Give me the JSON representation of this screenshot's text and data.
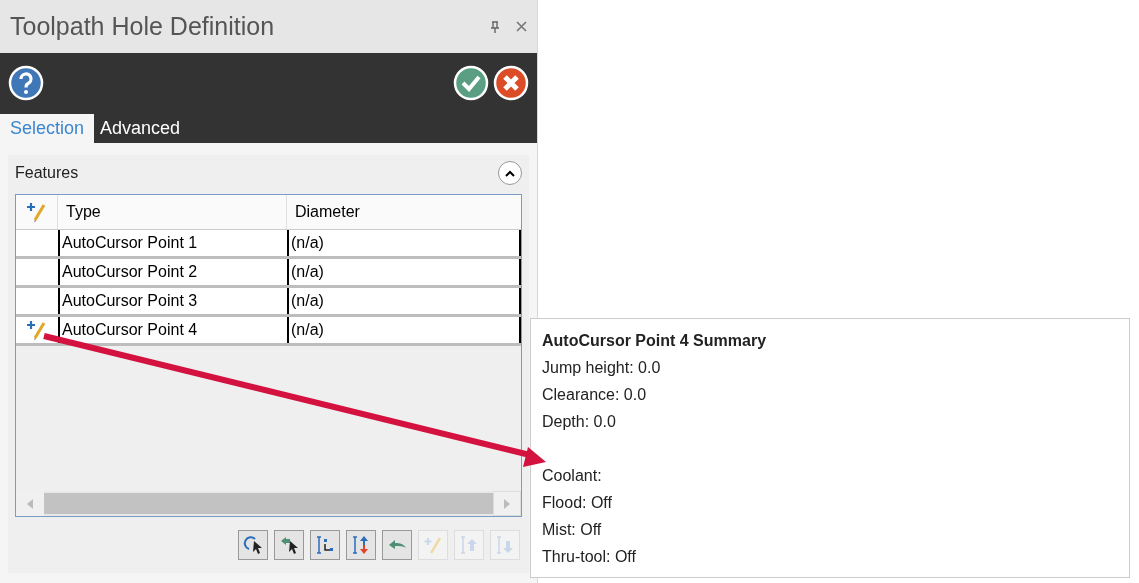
{
  "panel": {
    "title": "Toolpath Hole Definition"
  },
  "tabs": [
    {
      "label": "Selection",
      "selected": true
    },
    {
      "label": "Advanced",
      "selected": false
    }
  ],
  "group": {
    "title": "Features",
    "expanded": true
  },
  "table": {
    "columns": [
      "Type",
      "Diameter"
    ],
    "rows": [
      {
        "type": "AutoCursor Point 1",
        "diameter": "(n/a)",
        "editing": false
      },
      {
        "type": "AutoCursor Point 2",
        "diameter": "(n/a)",
        "editing": false
      },
      {
        "type": "AutoCursor Point 3",
        "diameter": "(n/a)",
        "editing": false
      },
      {
        "type": "AutoCursor Point 4",
        "diameter": "(n/a)",
        "editing": true
      }
    ]
  },
  "toolbar": [
    {
      "kind": "select",
      "disabled": false
    },
    {
      "kind": "deselect",
      "disabled": false
    },
    {
      "kind": "order",
      "disabled": false
    },
    {
      "kind": "reverse",
      "disabled": false
    },
    {
      "kind": "undo",
      "disabled": false
    },
    {
      "kind": "edit",
      "disabled": true
    },
    {
      "kind": "up",
      "disabled": true
    },
    {
      "kind": "down",
      "disabled": true
    }
  ],
  "tooltip": {
    "title": "AutoCursor Point 4 Summary",
    "sections": [
      [
        "Jump height: 0.0",
        "Clearance: 0.0",
        "Depth: 0.0"
      ],
      [
        "Coolant:",
        "Flood: Off",
        "Mist: Off",
        "Thru-tool: Off"
      ]
    ]
  }
}
